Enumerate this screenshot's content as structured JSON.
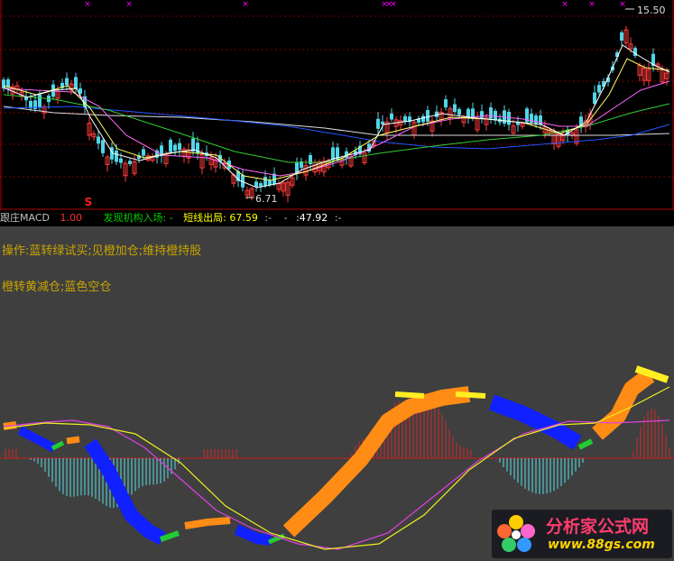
{
  "price_panel": {
    "high_label": "15.50",
    "low_label": "6.71",
    "signal_mark": "S",
    "colors": {
      "up": "#ff3b3b",
      "down": "#4fd6e8",
      "ma5": "#ffffff",
      "ma10": "#ffff66",
      "ma20": "#ff66ff",
      "ma60": "#33cc33",
      "ma120": "#2255ff",
      "ma250": "#dddddd",
      "cross": "#ff00ff"
    }
  },
  "status_bar": {
    "indicator_name": "跟庄MACD",
    "value": "1.00",
    "entry_label": "发现机构入场:",
    "entry_value": "-",
    "exit_label": "短线出局:",
    "exit_value": "67.59",
    "sep1": ":-",
    "v2_sep": "-",
    "v2": ":47.92",
    "sep2": ":-",
    "colors": {
      "name": "#c0c0c0",
      "value": "#ff3030",
      "entry": "#00cc00",
      "exit": "#ffff00",
      "sep": "#c0c0c0"
    }
  },
  "notes": {
    "line1": "操作:蓝转绿试买;见橙加仓;维持橙持股",
    "line2": "橙转黄减仓;蓝色空仓"
  },
  "logo": {
    "title": "分析家公式网",
    "url": "www.88gs.com"
  },
  "indicator_colors": {
    "blue": "#1020ff",
    "green": "#22cc33",
    "orange": "#ff8c14",
    "yellow": "#ffee22",
    "red_hist": "#d02828",
    "cyan_hist": "#55e0e8",
    "magenta_line": "#e040e0",
    "yellow_line": "#f0f020"
  }
}
